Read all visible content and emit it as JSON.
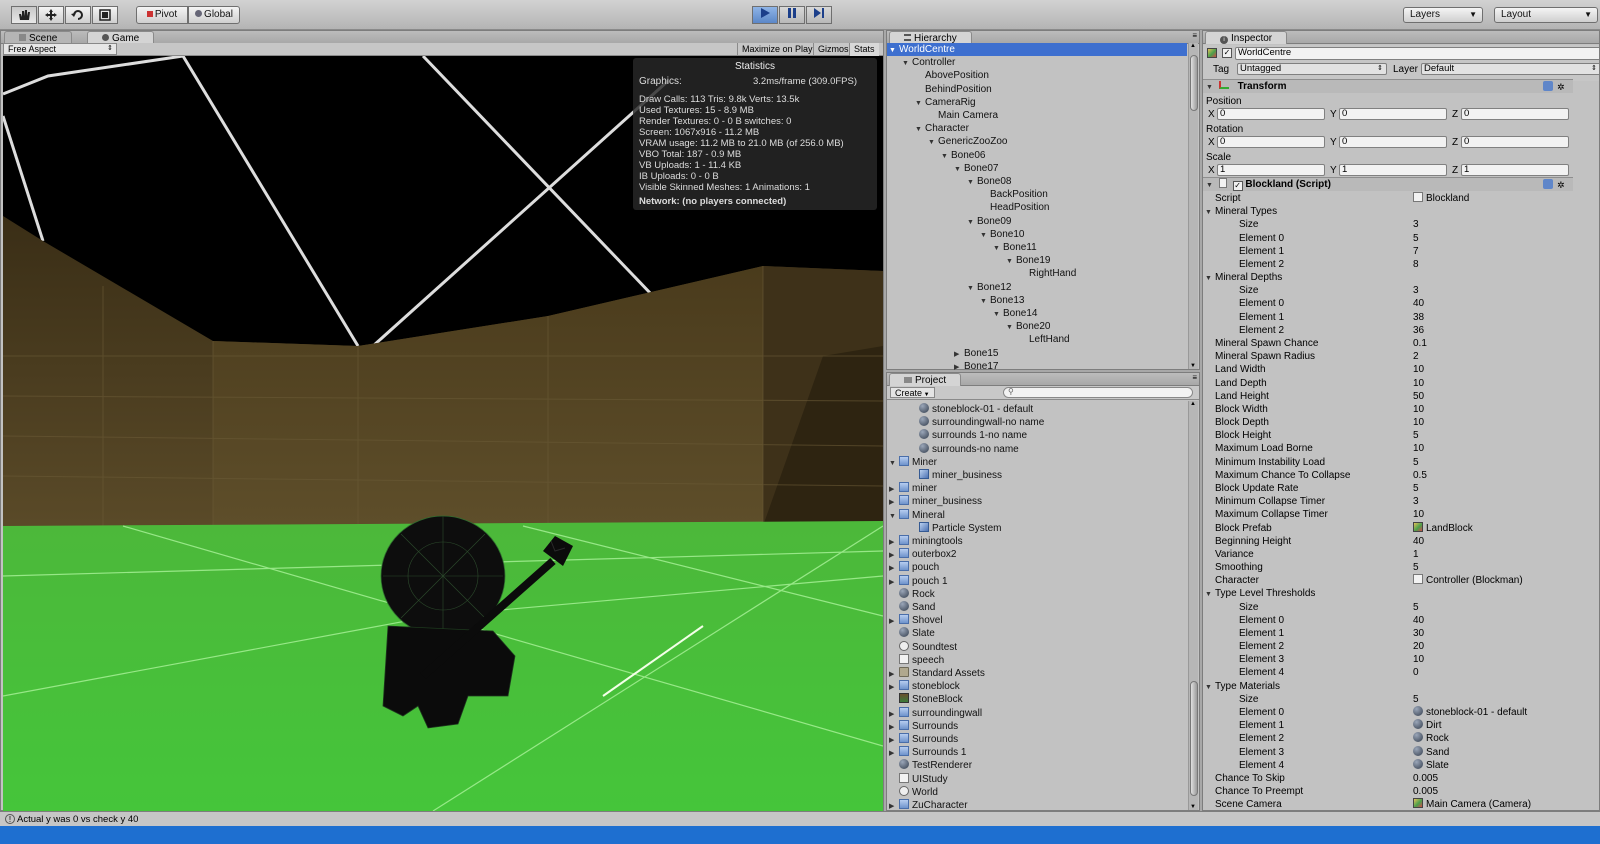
{
  "toolbar": {
    "pivot": "Pivot",
    "global": "Global",
    "layers": "Layers",
    "layout": "Layout"
  },
  "scene_tabs": {
    "scene": "Scene",
    "game": "Game"
  },
  "game_bar": {
    "aspect": "Free Aspect",
    "maximize": "Maximize on Play",
    "gizmos": "Gizmos",
    "stats": "Stats"
  },
  "stats": {
    "title": "Statistics",
    "graphics_label": "Graphics:",
    "graphics_value": "3.2ms/frame (309.0FPS)",
    "lines": [
      "Draw Calls: 113   Tris: 9.8k     Verts: 13.5k",
      "Used Textures: 15 - 8.9 MB",
      "Render Textures: 0 - 0 B   switches: 0",
      "Screen: 1067x916 - 11.2 MB",
      "VRAM usage: 11.2 MB to 21.0 MB (of 256.0 MB)",
      "VBO Total: 187 - 0.9 MB",
      "VB Uploads: 1 - 11.4 KB",
      "IB Uploads: 0 - 0 B",
      "Visible Skinned Meshes: 1        Animations: 1"
    ],
    "network": "Network: (no players connected)"
  },
  "hierarchy": {
    "tab": "Hierarchy",
    "items": [
      {
        "label": "WorldCentre",
        "indent": 0,
        "arrow": "▼"
      },
      {
        "label": "Controller",
        "indent": 1,
        "arrow": "▼"
      },
      {
        "label": "AbovePosition",
        "indent": 2,
        "arrow": ""
      },
      {
        "label": "BehindPosition",
        "indent": 2,
        "arrow": ""
      },
      {
        "label": "CameraRig",
        "indent": 2,
        "arrow": "▼"
      },
      {
        "label": "Main Camera",
        "indent": 3,
        "arrow": ""
      },
      {
        "label": "Character",
        "indent": 2,
        "arrow": "▼"
      },
      {
        "label": "GenericZooZoo",
        "indent": 3,
        "arrow": "▼"
      },
      {
        "label": "Bone06",
        "indent": 4,
        "arrow": "▼"
      },
      {
        "label": "Bone07",
        "indent": 5,
        "arrow": "▼"
      },
      {
        "label": "Bone08",
        "indent": 6,
        "arrow": "▼"
      },
      {
        "label": "BackPosition",
        "indent": 7,
        "arrow": ""
      },
      {
        "label": "HeadPosition",
        "indent": 7,
        "arrow": ""
      },
      {
        "label": "Bone09",
        "indent": 6,
        "arrow": "▼"
      },
      {
        "label": "Bone10",
        "indent": 7,
        "arrow": "▼"
      },
      {
        "label": "Bone11",
        "indent": 8,
        "arrow": "▼"
      },
      {
        "label": "Bone19",
        "indent": 9,
        "arrow": "▼"
      },
      {
        "label": "RightHand",
        "indent": 10,
        "arrow": ""
      },
      {
        "label": "Bone12",
        "indent": 6,
        "arrow": "▼"
      },
      {
        "label": "Bone13",
        "indent": 7,
        "arrow": "▼"
      },
      {
        "label": "Bone14",
        "indent": 8,
        "arrow": "▼"
      },
      {
        "label": "Bone20",
        "indent": 9,
        "arrow": "▼"
      },
      {
        "label": "LeftHand",
        "indent": 10,
        "arrow": ""
      },
      {
        "label": "Bone15",
        "indent": 5,
        "arrow": "▶"
      },
      {
        "label": "Bone17",
        "indent": 5,
        "arrow": "▶"
      }
    ]
  },
  "project": {
    "tab": "Project",
    "create": "Create",
    "items": [
      {
        "label": "stoneblock-01 - default",
        "indent": 2,
        "arrow": "",
        "icon": "sphere"
      },
      {
        "label": "surroundingwall-no name",
        "indent": 2,
        "arrow": "",
        "icon": "sphere"
      },
      {
        "label": "surrounds 1-no name",
        "indent": 2,
        "arrow": "",
        "icon": "sphere"
      },
      {
        "label": "surrounds-no name",
        "indent": 2,
        "arrow": "",
        "icon": "sphere"
      },
      {
        "label": "Miner",
        "indent": 0,
        "arrow": "▼",
        "icon": "prefab"
      },
      {
        "label": "miner_business",
        "indent": 2,
        "arrow": "",
        "icon": "mesh"
      },
      {
        "label": "miner",
        "indent": 0,
        "arrow": "▶",
        "icon": "prefab"
      },
      {
        "label": "miner_business",
        "indent": 0,
        "arrow": "▶",
        "icon": "prefab"
      },
      {
        "label": "Mineral",
        "indent": 0,
        "arrow": "▼",
        "icon": "prefab"
      },
      {
        "label": "Particle System",
        "indent": 2,
        "arrow": "",
        "icon": "mesh"
      },
      {
        "label": "miningtools",
        "indent": 0,
        "arrow": "▶",
        "icon": "prefab"
      },
      {
        "label": "outerbox2",
        "indent": 0,
        "arrow": "▶",
        "icon": "prefab"
      },
      {
        "label": "pouch",
        "indent": 0,
        "arrow": "▶",
        "icon": "prefab"
      },
      {
        "label": "pouch 1",
        "indent": 0,
        "arrow": "▶",
        "icon": "prefab"
      },
      {
        "label": "Rock",
        "indent": 0,
        "arrow": "",
        "icon": "sphere"
      },
      {
        "label": "Sand",
        "indent": 0,
        "arrow": "",
        "icon": "sphere"
      },
      {
        "label": "Shovel",
        "indent": 0,
        "arrow": "▶",
        "icon": "prefab"
      },
      {
        "label": "Slate",
        "indent": 0,
        "arrow": "",
        "icon": "sphere"
      },
      {
        "label": "Soundtest",
        "indent": 0,
        "arrow": "",
        "icon": "audio"
      },
      {
        "label": "speech",
        "indent": 0,
        "arrow": "",
        "icon": "doc"
      },
      {
        "label": "Standard Assets",
        "indent": 0,
        "arrow": "▶",
        "icon": "folder"
      },
      {
        "label": "stoneblock",
        "indent": 0,
        "arrow": "▶",
        "icon": "prefab"
      },
      {
        "label": "StoneBlock",
        "indent": 0,
        "arrow": "",
        "icon": "tex"
      },
      {
        "label": "surroundingwall",
        "indent": 0,
        "arrow": "▶",
        "icon": "prefab"
      },
      {
        "label": "Surrounds",
        "indent": 0,
        "arrow": "▶",
        "icon": "prefab"
      },
      {
        "label": "Surrounds",
        "indent": 0,
        "arrow": "▶",
        "icon": "prefab"
      },
      {
        "label": "Surrounds 1",
        "indent": 0,
        "arrow": "▶",
        "icon": "prefab"
      },
      {
        "label": "TestRenderer",
        "indent": 0,
        "arrow": "",
        "icon": "sphere"
      },
      {
        "label": "UIStudy",
        "indent": 0,
        "arrow": "",
        "icon": "doc"
      },
      {
        "label": "World",
        "indent": 0,
        "arrow": "",
        "icon": "audio"
      },
      {
        "label": "ZuCharacter",
        "indent": 0,
        "arrow": "▶",
        "icon": "prefab"
      }
    ]
  },
  "inspector": {
    "tab": "Inspector",
    "object_name": "WorldCentre",
    "tag_label": "Tag",
    "tag_value": "Untagged",
    "layer_label": "Layer",
    "layer_value": "Default",
    "transform": {
      "title": "Transform",
      "position": "Position",
      "rotation": "Rotation",
      "scale": "Scale",
      "pos": [
        "0",
        "0",
        "0"
      ],
      "rot": [
        "0",
        "0",
        "0"
      ],
      "scl": [
        "1",
        "1",
        "1"
      ]
    },
    "script_title": "Blockland (Script)",
    "rows": [
      {
        "k": "Script",
        "v": "Blockland",
        "indent": 0,
        "arrow": "",
        "icon": "doc"
      },
      {
        "k": "Mineral Types",
        "v": "",
        "indent": 0,
        "arrow": "▼",
        "icon": ""
      },
      {
        "k": "Size",
        "v": "3",
        "indent": 2,
        "arrow": "",
        "icon": ""
      },
      {
        "k": "Element 0",
        "v": "5",
        "indent": 2,
        "arrow": "",
        "icon": ""
      },
      {
        "k": "Element 1",
        "v": "7",
        "indent": 2,
        "arrow": "",
        "icon": ""
      },
      {
        "k": "Element 2",
        "v": "8",
        "indent": 2,
        "arrow": "",
        "icon": ""
      },
      {
        "k": "Mineral Depths",
        "v": "",
        "indent": 0,
        "arrow": "▼",
        "icon": ""
      },
      {
        "k": "Size",
        "v": "3",
        "indent": 2,
        "arrow": "",
        "icon": ""
      },
      {
        "k": "Element 0",
        "v": "40",
        "indent": 2,
        "arrow": "",
        "icon": ""
      },
      {
        "k": "Element 1",
        "v": "38",
        "indent": 2,
        "arrow": "",
        "icon": ""
      },
      {
        "k": "Element 2",
        "v": "36",
        "indent": 2,
        "arrow": "",
        "icon": ""
      },
      {
        "k": "Mineral Spawn Chance",
        "v": "0.1",
        "indent": 0,
        "arrow": "",
        "icon": ""
      },
      {
        "k": "Mineral Spawn Radius",
        "v": "2",
        "indent": 0,
        "arrow": "",
        "icon": ""
      },
      {
        "k": "Land Width",
        "v": "10",
        "indent": 0,
        "arrow": "",
        "icon": ""
      },
      {
        "k": "Land Depth",
        "v": "10",
        "indent": 0,
        "arrow": "",
        "icon": ""
      },
      {
        "k": "Land Height",
        "v": "50",
        "indent": 0,
        "arrow": "",
        "icon": ""
      },
      {
        "k": "Block Width",
        "v": "10",
        "indent": 0,
        "arrow": "",
        "icon": ""
      },
      {
        "k": "Block Depth",
        "v": "10",
        "indent": 0,
        "arrow": "",
        "icon": ""
      },
      {
        "k": "Block Height",
        "v": "5",
        "indent": 0,
        "arrow": "",
        "icon": ""
      },
      {
        "k": "Maximum Load Borne",
        "v": "10",
        "indent": 0,
        "arrow": "",
        "icon": ""
      },
      {
        "k": "Minimum Instability Load",
        "v": "5",
        "indent": 0,
        "arrow": "",
        "icon": ""
      },
      {
        "k": "Maximum Chance To Collapse",
        "v": "0.5",
        "indent": 0,
        "arrow": "",
        "icon": ""
      },
      {
        "k": "Block Update Rate",
        "v": "5",
        "indent": 0,
        "arrow": "",
        "icon": ""
      },
      {
        "k": "Minimum Collapse Timer",
        "v": "3",
        "indent": 0,
        "arrow": "",
        "icon": ""
      },
      {
        "k": "Maximum Collapse Timer",
        "v": "10",
        "indent": 0,
        "arrow": "",
        "icon": ""
      },
      {
        "k": "Block Prefab",
        "v": "LandBlock",
        "indent": 0,
        "arrow": "",
        "icon": "cube"
      },
      {
        "k": "Beginning Height",
        "v": "40",
        "indent": 0,
        "arrow": "",
        "icon": ""
      },
      {
        "k": "Variance",
        "v": "1",
        "indent": 0,
        "arrow": "",
        "icon": ""
      },
      {
        "k": "Smoothing",
        "v": "5",
        "indent": 0,
        "arrow": "",
        "icon": ""
      },
      {
        "k": "Character",
        "v": "Controller (Blockman)",
        "indent": 0,
        "arrow": "",
        "icon": "doc"
      },
      {
        "k": "Type Level Thresholds",
        "v": "",
        "indent": 0,
        "arrow": "▼",
        "icon": ""
      },
      {
        "k": "Size",
        "v": "5",
        "indent": 2,
        "arrow": "",
        "icon": ""
      },
      {
        "k": "Element 0",
        "v": "40",
        "indent": 2,
        "arrow": "",
        "icon": ""
      },
      {
        "k": "Element 1",
        "v": "30",
        "indent": 2,
        "arrow": "",
        "icon": ""
      },
      {
        "k": "Element 2",
        "v": "20",
        "indent": 2,
        "arrow": "",
        "icon": ""
      },
      {
        "k": "Element 3",
        "v": "10",
        "indent": 2,
        "arrow": "",
        "icon": ""
      },
      {
        "k": "Element 4",
        "v": "0",
        "indent": 2,
        "arrow": "",
        "icon": ""
      },
      {
        "k": "Type Materials",
        "v": "",
        "indent": 0,
        "arrow": "▼",
        "icon": ""
      },
      {
        "k": "Size",
        "v": "5",
        "indent": 2,
        "arrow": "",
        "icon": ""
      },
      {
        "k": "Element 0",
        "v": "stoneblock-01 - default",
        "indent": 2,
        "arrow": "",
        "icon": "sphere"
      },
      {
        "k": "Element 1",
        "v": "Dirt",
        "indent": 2,
        "arrow": "",
        "icon": "sphere"
      },
      {
        "k": "Element 2",
        "v": "Rock",
        "indent": 2,
        "arrow": "",
        "icon": "sphere"
      },
      {
        "k": "Element 3",
        "v": "Sand",
        "indent": 2,
        "arrow": "",
        "icon": "sphere"
      },
      {
        "k": "Element 4",
        "v": "Slate",
        "indent": 2,
        "arrow": "",
        "icon": "sphere"
      },
      {
        "k": "Chance To Skip",
        "v": "0.005",
        "indent": 0,
        "arrow": "",
        "icon": ""
      },
      {
        "k": "Chance To Preempt",
        "v": "0.005",
        "indent": 0,
        "arrow": "",
        "icon": ""
      },
      {
        "k": "Scene Camera",
        "v": "Main Camera (Camera)",
        "indent": 0,
        "arrow": "",
        "icon": "cube"
      }
    ]
  },
  "status": {
    "message": "Actual y was 0 vs check y 40"
  }
}
